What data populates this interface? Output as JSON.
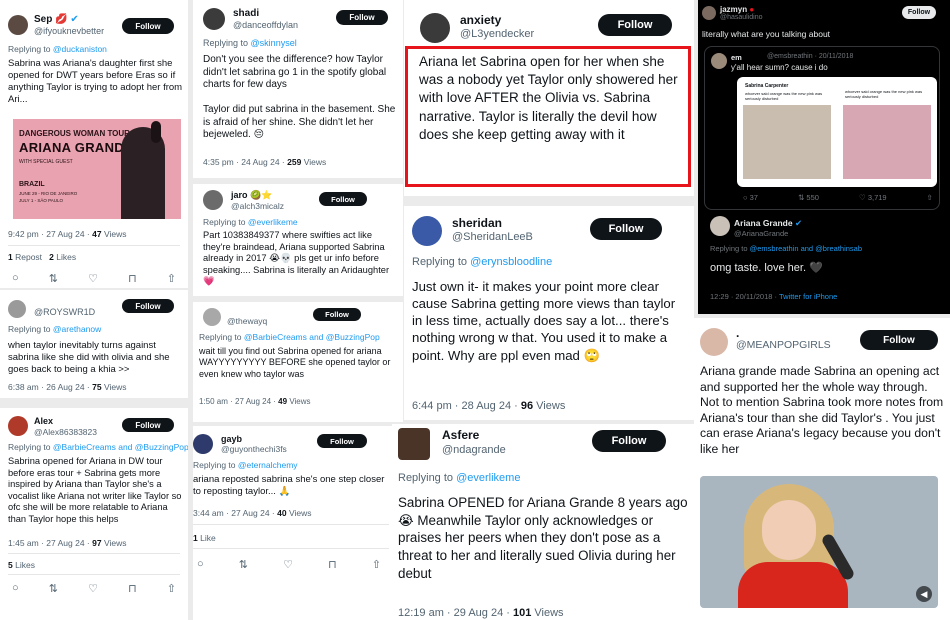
{
  "col1": {
    "t1": {
      "name": "Sep",
      "emoji": "💋",
      "handle": "@ifyouknevbetter",
      "follow": "Follow",
      "reply_prefix": "Replying to",
      "reply_to": "@duckaniston",
      "text": "Sabrina was Ariana's daughter first she opened for DWT years before Eras so if anything Taylor is trying to adopt her from Ari...",
      "poster_line1": "DANGEROUS WOMAN TOUR",
      "poster_line2": "ARIANA GRANDE",
      "poster_line3": "WITH SPECIAL GUEST",
      "poster_country": "BRAZIL",
      "poster_date1": "JUNE 29 - RIO DE JANEIRO",
      "poster_date2": "JULY 1 - SÃO PAULO",
      "time": "9:42 pm · 27 Aug 24 ·",
      "views_count": "47",
      "views_label": "Views",
      "reposts_count": "1",
      "reposts_label": "Repost",
      "likes_count": "2",
      "likes_label": "Likes"
    },
    "t2": {
      "handle": "@ROYSWR1D",
      "follow": "Follow",
      "reply_prefix": "Replying to",
      "reply_to": "@arethanow",
      "text": "when taylor inevitably turns against sabrina like she did with olivia and she goes back to being a khia >>",
      "time": "6:38 am · 26 Aug 24 ·",
      "views_count": "75",
      "views_label": "Views"
    },
    "t3": {
      "name": "Alex",
      "handle": "@Alex86383823",
      "follow": "Follow",
      "reply_prefix": "Replying to",
      "reply_to": "@BarbieCreams and @BuzzingPop",
      "text": "Sabrina opened for Ariana in DW tour before eras tour + Sabrina gets more inspired by Ariana than Taylor she's a vocalist like Ariana not writer like Taylor so ofc she will be more relatable to Ariana than Taylor hope this helps",
      "time": "1:45 am · 27 Aug 24 ·",
      "views_count": "97",
      "views_label": "Views",
      "likes_count": "5",
      "likes_label": "Likes"
    }
  },
  "col2": {
    "t1": {
      "name": "shadi",
      "handle": "@danceoffdylan",
      "follow": "Follow",
      "reply_prefix": "Replying to",
      "reply_to": "@skinnysel",
      "text": "Don't you see the difference? how Taylor didn't let sabrina go 1 in the spotify global charts for few days\n\nTaylor did put sabrina in the basement. She is afraid of her shine. She didn't let her bejeweled. 😔",
      "time": "4:35 pm · 24 Aug 24 ·",
      "views_count": "259",
      "views_label": "Views"
    },
    "t2": {
      "name": "jaro",
      "handle": "@alch3micalz",
      "follow": "Follow",
      "reply_prefix": "Replying to",
      "reply_to": "@everlikeme",
      "text": "Part 10383849377 where swifties act like they're braindead, Ariana supported Sabrina already in 2017 😭💀 pls get ur info before speaking.... Sabrina is literally an Aridaughter 💗"
    },
    "t3": {
      "handle": "@thewayq",
      "follow": "Follow",
      "reply_prefix": "Replying to",
      "reply_to": "@BarbieCreams and @BuzzingPop",
      "text": "wait till you find out Sabrina opened for ariana WAYYYYYYYYY BEFORE she opened taylor or even knew who taylor was",
      "time": "1:50 am · 27 Aug 24 ·",
      "views_count": "49",
      "views_label": "Views"
    },
    "t4": {
      "name": "gayb",
      "handle": "@guyonthechi3fs",
      "follow": "Follow",
      "reply_prefix": "Replying to",
      "reply_to": "@eternalchemy",
      "text": "ariana reposted sabrina she's one step closer to reposting taylor... 🙏",
      "time": "3:44 am · 27 Aug 24 ·",
      "views_count": "40",
      "views_label": "Views",
      "likes_count": "1",
      "likes_label": "Like"
    }
  },
  "col3": {
    "t1": {
      "name": "anxiety",
      "handle": "@L3yendecker",
      "follow": "Follow",
      "text": "Ariana let Sabrina open for her when she was a nobody yet Taylor only showered her with love AFTER the Olivia vs. Sabrina narrative. Taylor is literally the devil how does she keep getting away with it"
    },
    "t2": {
      "name": "sheridan",
      "handle": "@SheridanLeeB",
      "follow": "Follow",
      "reply_prefix": "Replying to",
      "reply_to": "@erynsbloodline",
      "text": "Just own it- it makes your point more clear cause Sabrina getting more views than taylor in less time, actually does say a lot... there's nothing wrong w that. You used it to make a point.  Why are ppl even mad 🙄",
      "time": "6:44 pm · 28 Aug 24 ·",
      "views_count": "96",
      "views_label": "Views"
    },
    "t3": {
      "name": "Asfere",
      "handle": "@ndagrande",
      "follow": "Follow",
      "reply_prefix": "Replying to",
      "reply_to": "@everlikeme",
      "text": "Sabrina OPENED for Ariana Grande 8 years ago 😭 Meanwhile Taylor only acknowledges or praises her peers when they don't pose as a threat to her and literally sued Olivia during her debut",
      "time": "12:19 am · 29 Aug 24 ·",
      "views_count": "101",
      "views_label": "Views"
    }
  },
  "col4": {
    "t1": {
      "name": "jazmyn",
      "handle": "@hasaulidino",
      "follow": "Follow",
      "text": "literally what are you talking about",
      "quote_name": "em",
      "quote_handle": "@emsbreathin · 20/11/2018",
      "quote_text": "y'all hear sumn? cause i do",
      "quote_inner_name": "Sabrina Carpenter",
      "quote_inner_text1": "whoever said orange was the new pink was seriously disturbed",
      "quote_inner_text2": "whoever said orange was the new pink was seriously disturbed",
      "quote_replies": "37",
      "quote_reposts": "550",
      "quote_likes": "3,719",
      "reply_name": "Ariana Grande",
      "reply_handle": "@ArianaGrande",
      "reply_prefix": "Replying to",
      "reply_to": "@emsbreathin and @breathinsab",
      "reply_text": "omg taste. love her. 🖤",
      "reply_time": "12:29 · 20/11/2018 ·",
      "reply_source": "Twitter for iPhone"
    },
    "t2": {
      "name": ".",
      "handle": "@MEANPOPGIRLS",
      "follow": "Follow",
      "text": "Ariana grande made Sabrina an opening act and supported her the whole way through. Not to mention Sabrina took more notes from Ariana's tour than she did Taylor's . You just can erase Ariana's legacy because you don't like her"
    }
  },
  "icons": {
    "reply": "💬",
    "repost": "⇄",
    "like": "♡",
    "bookmark": "⊓",
    "share": "⇧"
  },
  "colors": {
    "highlight": "#e8141b",
    "link": "#1d9bf0",
    "follow_bg": "#0f1419"
  }
}
